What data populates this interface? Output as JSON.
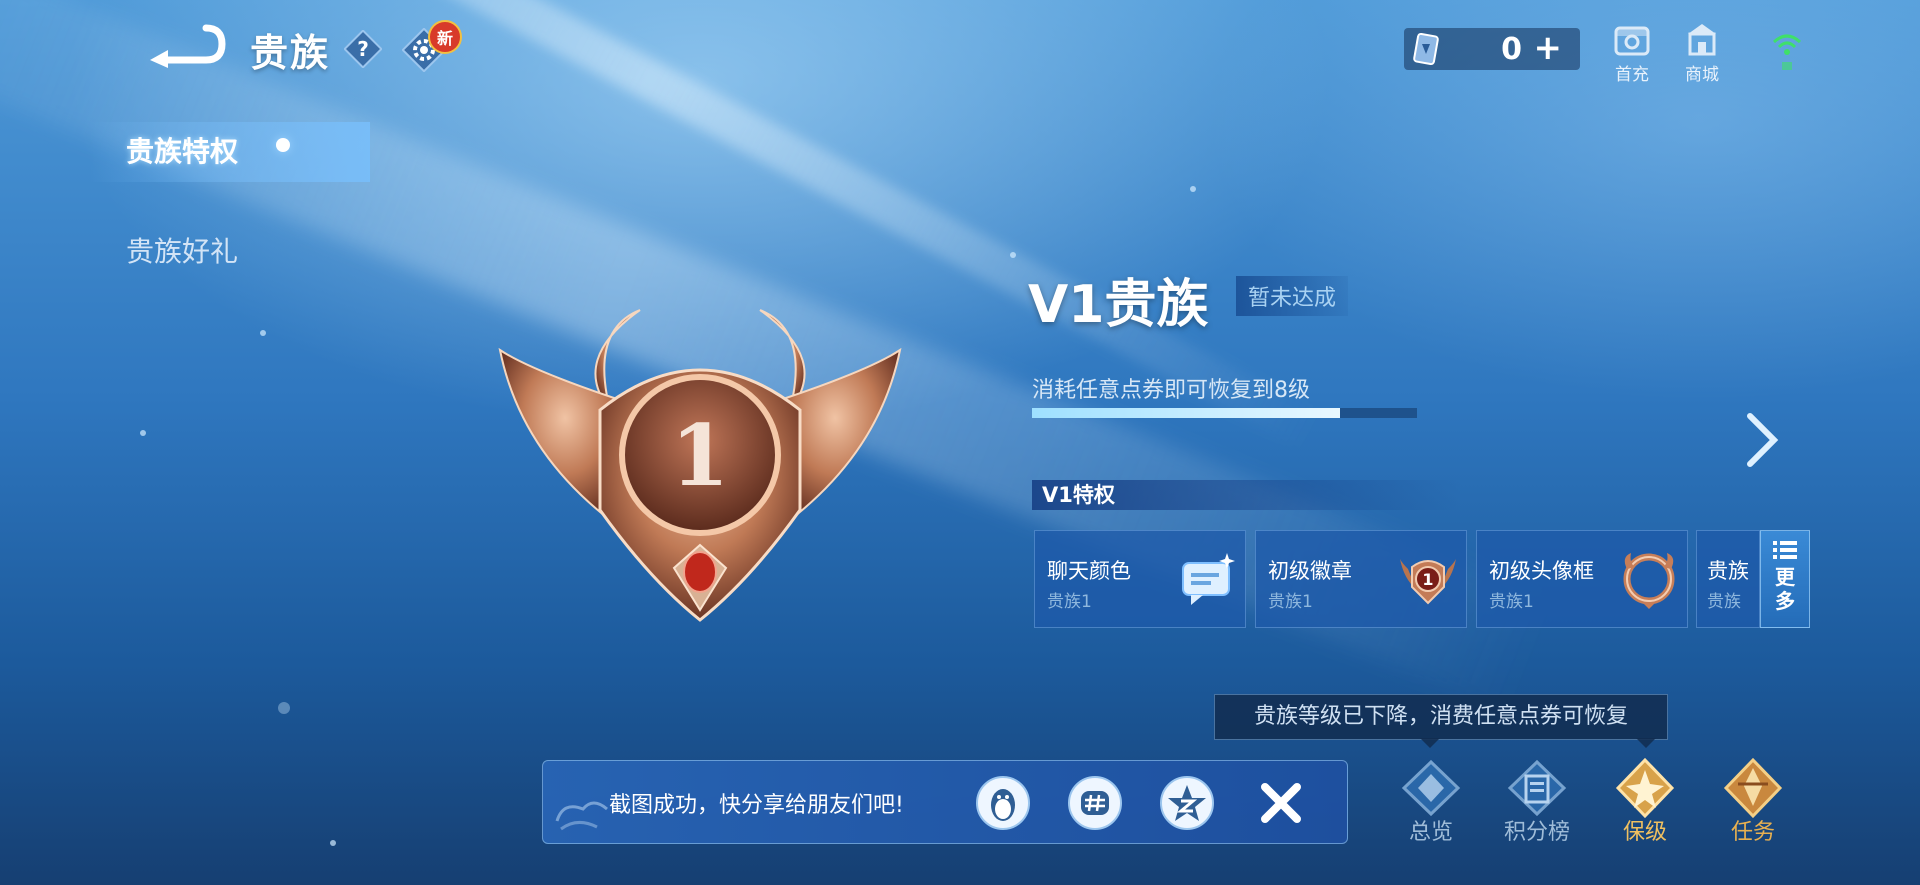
{
  "header": {
    "title": "贵族",
    "new_badge": "新",
    "coupon_value": "0",
    "coupon_plus": "+",
    "first_charge_label": "首充",
    "shop_label": "商城"
  },
  "sidebar": {
    "items": [
      {
        "label": "贵族特权"
      },
      {
        "label": "贵族好礼"
      }
    ]
  },
  "emblem": {
    "number": "1"
  },
  "main": {
    "level_title": "V1贵族",
    "status": "暂未达成",
    "restore_text": "消耗任意点券即可恢复到8级",
    "progress_fraction": 0.8,
    "privileges_header": "V1特权",
    "privileges": [
      {
        "name": "聊天颜色",
        "sub": "贵族1"
      },
      {
        "name": "初级徽章",
        "sub": "贵族1",
        "badge": "1"
      },
      {
        "name": "初级头像框",
        "sub": "贵族1"
      },
      {
        "name": "贵族",
        "sub": "贵族"
      }
    ],
    "more_label": "更多"
  },
  "tooltip": {
    "text": "贵族等级已下降，消费任意点券可恢复"
  },
  "bottom_tabs": [
    {
      "label": "总览"
    },
    {
      "label": "积分榜"
    },
    {
      "label": "保级"
    },
    {
      "label": "任务"
    }
  ],
  "share_bar": {
    "text": "截图成功，快分享给朋友们吧!"
  },
  "colors": {
    "accent_gold": "#e3b04a",
    "bronze": "#b06a48",
    "panel_blue": "#1e5aaa"
  }
}
